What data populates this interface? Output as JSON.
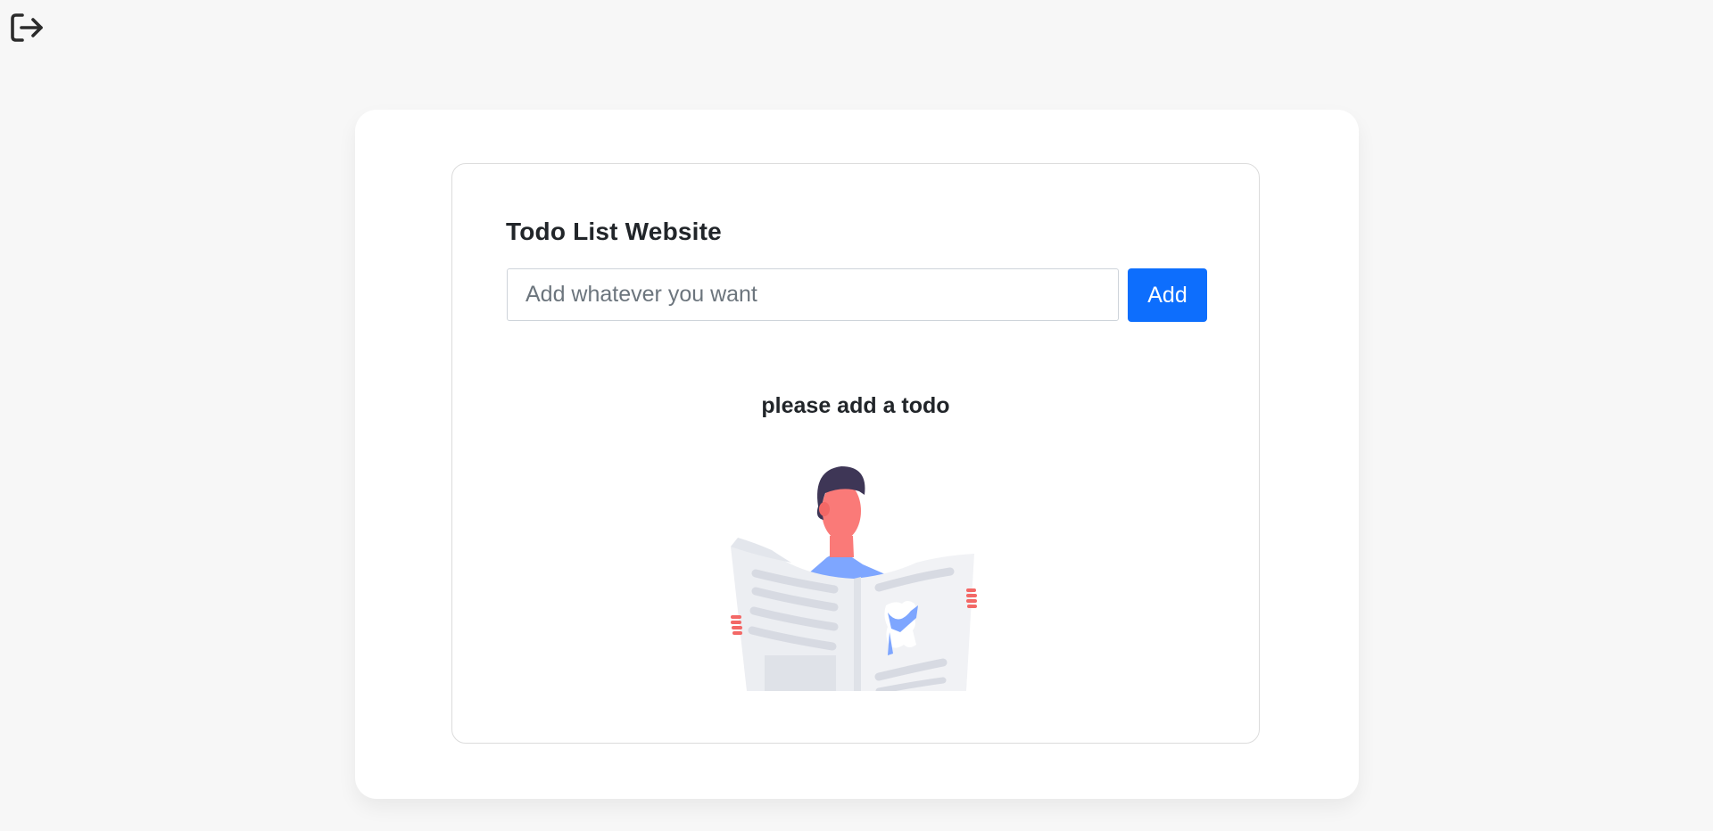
{
  "header": {
    "logout_icon": "logout-icon"
  },
  "card": {
    "title": "Todo List Website",
    "input": {
      "placeholder": "Add whatever you want",
      "value": ""
    },
    "add_label": "Add",
    "empty_message": "please add a todo",
    "illustration_icon": "person-reading-newspaper"
  },
  "colors": {
    "primary": "#0d6efd",
    "background": "#f7f7f7",
    "card": "#ffffff"
  }
}
